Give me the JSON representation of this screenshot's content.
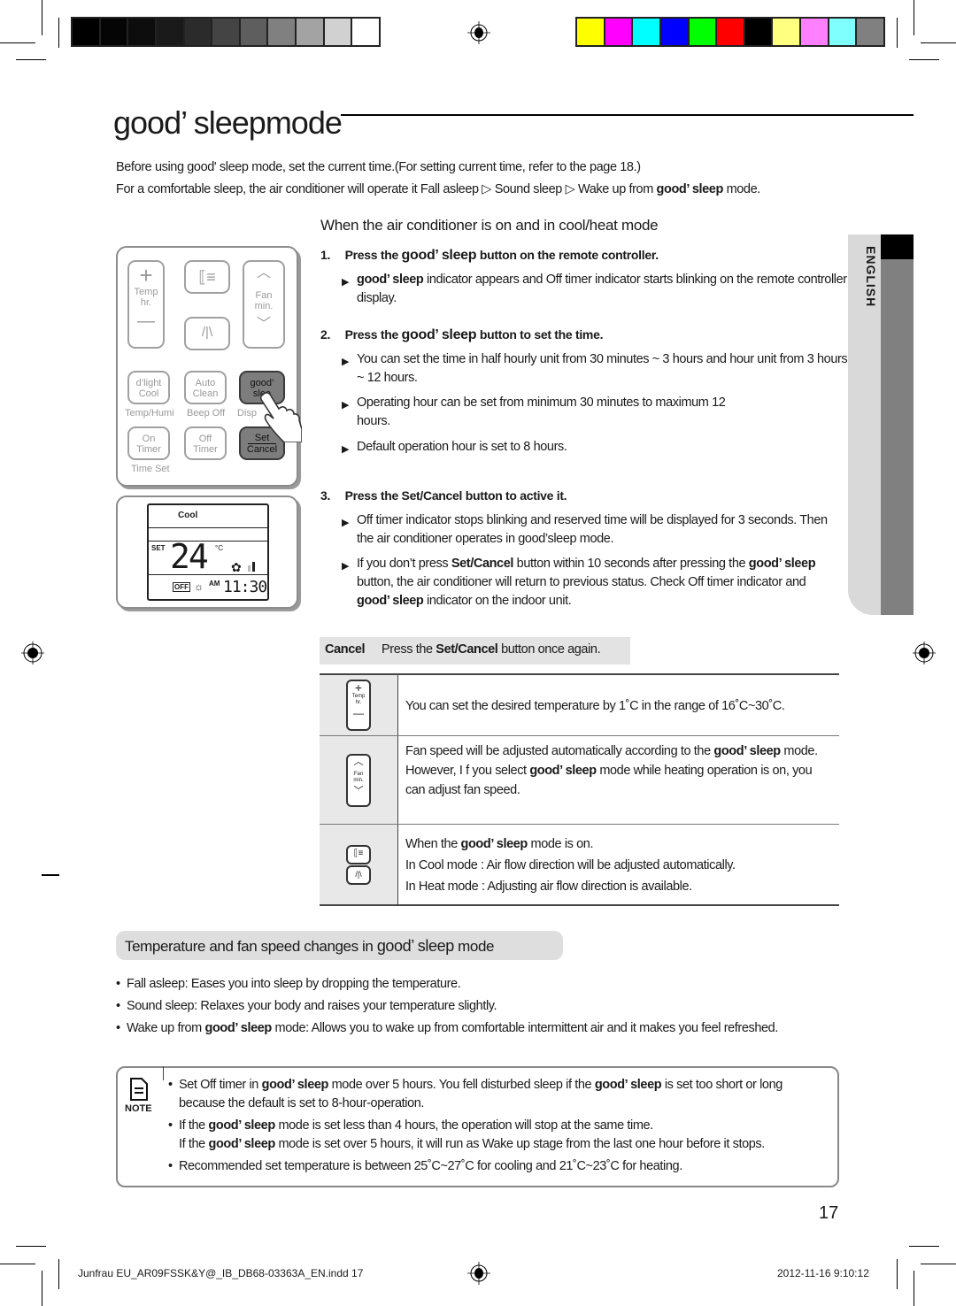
{
  "print_marks": {
    "gray_swatches": [
      "#000000",
      "#050505",
      "#0d0d0d",
      "#1a1a1a",
      "#2b2b2b",
      "#444444",
      "#5e5e5e",
      "#808080",
      "#a3a3a3",
      "#d1d1d1",
      "#ffffff"
    ],
    "color_swatches": [
      "#ffff00",
      "#ff00ff",
      "#00ffff",
      "#0000ff",
      "#00ff00",
      "#ff0000",
      "#000000",
      "#ffff80",
      "#ff80ff",
      "#80ffff",
      "#808080"
    ]
  },
  "page": {
    "title_brand": "good’ sleep",
    "title_suffix": "mode",
    "intro_1": "Before using good' sleep mode, set the current time.(For setting current time, refer to the page 18.)",
    "intro_2_a": "For a comfortable sleep, the air conditioner will operate it Fall asleep",
    "intro_2_b": "Sound sleep",
    "intro_2_c": "Wake up from",
    "intro_2_brand": "good’ sleep",
    "intro_2_d": "mode.",
    "side_tab": "ENGLISH",
    "page_number": "17"
  },
  "section1": {
    "heading": "When the air conditioner is on and in cool/heat mode",
    "steps": [
      {
        "num": "1.",
        "pre": "Press the",
        "brand": "good’ sleep",
        "post": "button on the remote controller.",
        "bullets": [
          {
            "brand": "good’ sleep",
            "text": "indicator appears and Off timer indicator starts blinking on the remote controller display."
          }
        ]
      },
      {
        "num": "2.",
        "pre": "Press the",
        "brand": "good’ sleep",
        "post": "button to set the time.",
        "bullets": [
          {
            "text": "You can set the time in half hourly unit from 30 minutes ~ 3 hours and hour unit from 3 hours ~ 12 hours."
          },
          {
            "text": "Operating hour can be set from minimum 30 minutes to maximum 12 hours."
          },
          {
            "text": "Default operation hour is set to 8 hours."
          }
        ]
      },
      {
        "num": "3.",
        "pre": "Press the",
        "bold": "Set/Cancel",
        "post": "button to active it.",
        "bullets": [
          {
            "text": "Off timer indicator stops blinking and reserved time will be displayed for 3 seconds. Then the air conditioner operates in good’sleep mode."
          },
          {
            "a": "If you don’t press",
            "bold": "Set/Cancel",
            "b": "button within 10 seconds after pressing the",
            "brand": "good’ sleep",
            "c": "button, the air conditioner will return to previous status.  Check Off timer indicator and",
            "brand2": "good’ sleep",
            "d": "indicator on the indoor unit."
          }
        ]
      }
    ],
    "cancel": {
      "label": "Cancel",
      "pre": "Press the",
      "bold": "Set/Cancel",
      "post": "button once again."
    }
  },
  "remote": {
    "temp_label": "Temp",
    "temp_sub": "hr.",
    "fan_label": "Fan",
    "fan_sub": "min.",
    "btn_dlight": "d’light",
    "btn_dlight2": "Cool",
    "btn_auto": "Auto",
    "btn_auto2": "Clean",
    "btn_good": "good’",
    "btn_good2": "slee",
    "lbl_temphumi": "Temp/Humi",
    "lbl_beep": "Beep Off",
    "lbl_disp": "Disp",
    "btn_on": "On",
    "btn_on2": "Timer",
    "btn_off": "Off",
    "btn_off2": "Timer",
    "btn_set": "Set",
    "btn_cancel": "Cancel",
    "lbl_timeset": "Time Set"
  },
  "display": {
    "mode": "Cool",
    "set_label": "SET",
    "temperature": "24",
    "unit": "°C",
    "off_label": "OFF",
    "ampm": "AM",
    "time": "11:30"
  },
  "table": {
    "rows": [
      {
        "icon": "temp-button-icon",
        "icon_top": "+",
        "icon_mid1": "Temp",
        "icon_mid2": "hr.",
        "icon_bot": "—",
        "text": "You can set the desired temperature by 1˚C in the range of 16˚C~30˚C."
      },
      {
        "icon": "fan-button-icon",
        "icon_top": "︿",
        "icon_mid1": "Fan",
        "icon_mid2": "min.",
        "icon_bot": "﹀",
        "a": "Fan speed will be adjusted automatically according to the",
        "brand": "good’ sleep",
        "b": "mode.",
        "c": "However, I f you select",
        "brand2": "good’ sleep",
        "d": "mode while heating operation is on, you can adjust fan speed."
      },
      {
        "icon": "airflow-buttons-icon",
        "a": "When the",
        "brand": "good’ sleep",
        "b": "mode is on.",
        "c": "In Cool mode : Air flow direction will be adjusted automatically.",
        "d": "In Heat mode : Adjusting air flow direction is available."
      }
    ]
  },
  "section2": {
    "heading_pre": "Temperature and fan speed changes in",
    "heading_brand": "good’ sleep",
    "heading_post": "mode",
    "bullets": [
      {
        "text": "Fall asleep: Eases you into sleep by dropping the temperature."
      },
      {
        "text": "Sound sleep: Relaxes your body and raises your temperature slightly."
      },
      {
        "a": "Wake up from",
        "brand": "good’ sleep",
        "b": "mode: Allows you to wake up from comfortable intermittent air and it makes you feel refreshed."
      }
    ]
  },
  "note": {
    "label": "NOTE",
    "items": [
      {
        "a": "Set Off timer in",
        "brand": "good’ sleep",
        "b": "mode over 5 hours. You fell disturbed sleep if the",
        "brand2": "good’ sleep",
        "c": "is set too short or long",
        "d": "because the default is set to 8-hour-operation."
      },
      {
        "a": "If the",
        "brand": "good’ sleep",
        "b": "mode is set less than 4 hours, the operation will stop at the same time.",
        "c": "If the",
        "brand2": "good’ sleep",
        "d": "mode is set over 5 hours, it will run as Wake up stage from the last one hour before it stops."
      },
      {
        "text": "Recommended set temperature is between 25˚C~27˚C for cooling and 21˚C~23˚C for heating."
      }
    ]
  },
  "footer": {
    "file": "Junfrau EU_AR09FSSK&Y@_IB_DB68-03363A_EN.indd   17",
    "timestamp": "2012-11-16   9:10:12"
  }
}
